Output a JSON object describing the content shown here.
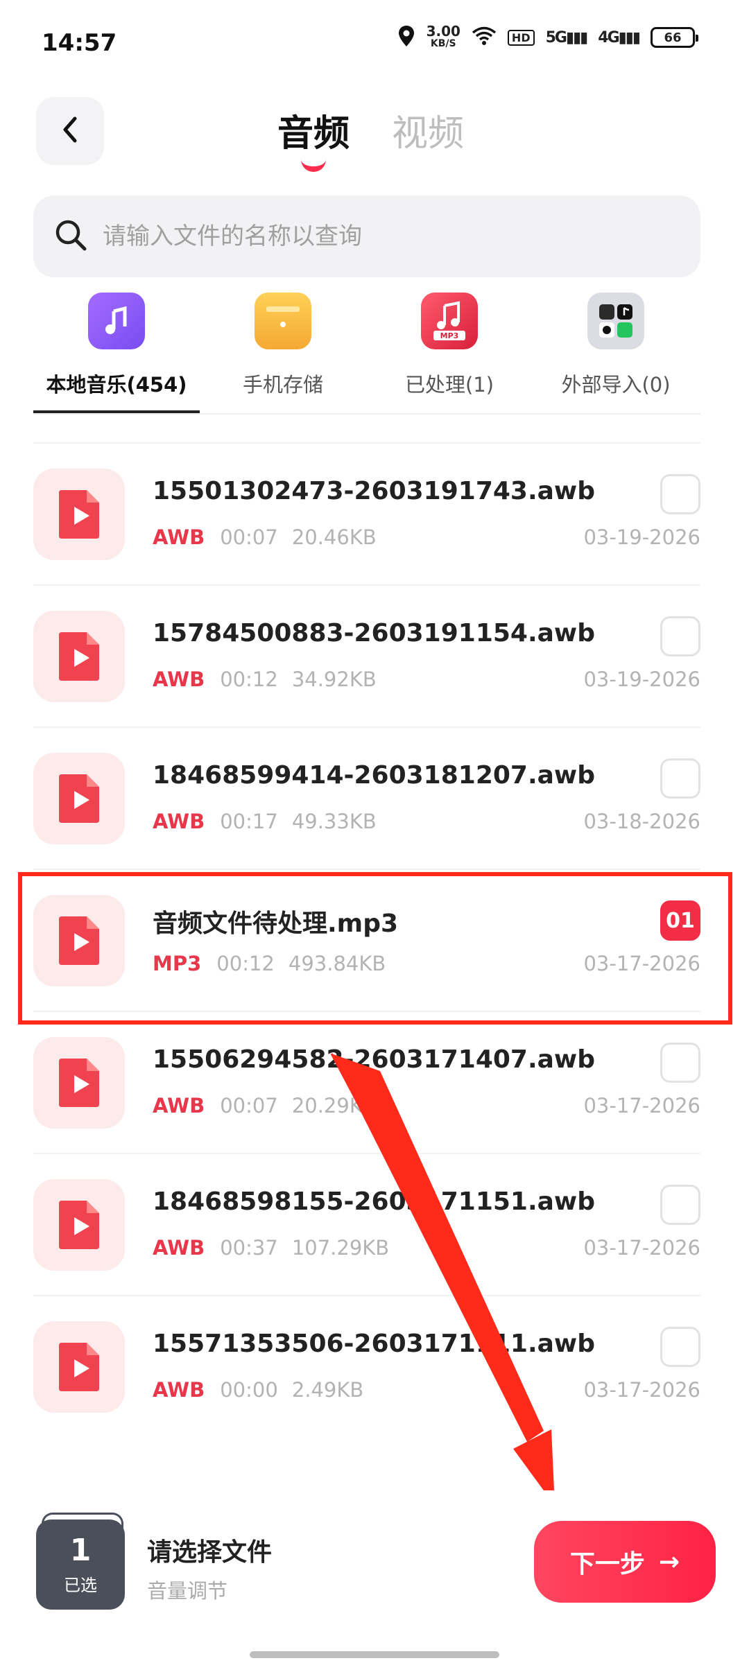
{
  "status_bar": {
    "time": "14:57",
    "net_speed": "3.00",
    "net_unit": "KB/S",
    "hd": "HD",
    "sig1": "5G",
    "sig2": "4G",
    "battery": "66"
  },
  "header": {
    "tabs": [
      {
        "label": "音频",
        "active": true
      },
      {
        "label": "视频",
        "active": false
      }
    ]
  },
  "search": {
    "placeholder": "请输入文件的名称以查询"
  },
  "categories": [
    {
      "label": "本地音乐(454)",
      "icon": "music-note-icon",
      "color": "#8a5cf5",
      "active": true
    },
    {
      "label": "手机存储",
      "icon": "storage-box-icon",
      "color": "#f5b63a",
      "active": false
    },
    {
      "label": "已处理(1)",
      "icon": "mp3-processed-icon",
      "color": "#e8364a",
      "active": false
    },
    {
      "label": "外部导入(0)",
      "icon": "apps-grid-icon",
      "color": "#dcdce4",
      "active": false
    }
  ],
  "files": [
    {
      "name": "15501302473-2603191743.awb",
      "type": "AWB",
      "duration": "00:07",
      "size": "20.46KB",
      "date": "03-19-2026",
      "selected": false
    },
    {
      "name": "15784500883-2603191154.awb",
      "type": "AWB",
      "duration": "00:12",
      "size": "34.92KB",
      "date": "03-19-2026",
      "selected": false
    },
    {
      "name": "18468599414-2603181207.awb",
      "type": "AWB",
      "duration": "00:17",
      "size": "49.33KB",
      "date": "03-18-2026",
      "selected": false
    },
    {
      "name": "音频文件待处理.mp3",
      "type": "MP3",
      "duration": "00:12",
      "size": "493.84KB",
      "date": "03-17-2026",
      "selected": true,
      "order": "01"
    },
    {
      "name": "15506294582-2603171407.awb",
      "type": "AWB",
      "duration": "00:07",
      "size": "20.29KB",
      "date": "03-17-2026",
      "selected": false
    },
    {
      "name": "18468598155-2603171151.awb",
      "type": "AWB",
      "duration": "00:37",
      "size": "107.29KB",
      "date": "03-17-2026",
      "selected": false
    },
    {
      "name": "15571353506-2603171111.awb",
      "type": "AWB",
      "duration": "00:00",
      "size": "2.49KB",
      "date": "03-17-2026",
      "selected": false
    }
  ],
  "bottom": {
    "selected_count": "1",
    "selected_label": "已选",
    "hint_title": "请选择文件",
    "hint_sub": "音量调节",
    "next_label": "下一步",
    "next_arrow": "→"
  },
  "colors": {
    "accent": "#f22d45",
    "highlight": "#ff2a1a"
  }
}
